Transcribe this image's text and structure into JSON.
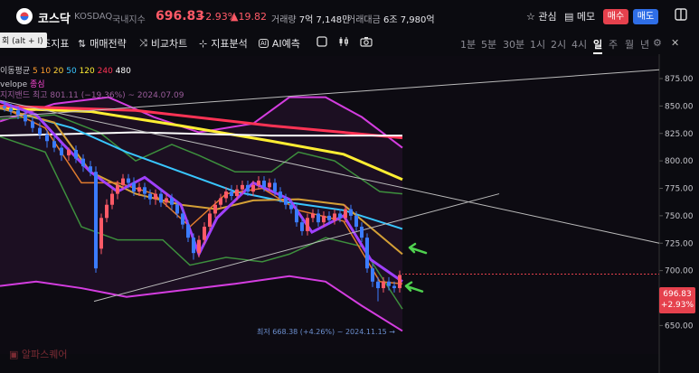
{
  "header": {
    "name": "코스닥",
    "code": "KOSDAQ",
    "market": "국내지수",
    "price": "696.83",
    "change_pct": "+2.93%",
    "change": "▲19.82",
    "volume_label": "거래량",
    "volume": "7억 7,148만",
    "amount_label": "거래대금",
    "amount": "6조 7,980억",
    "interest": "관심",
    "memo": "메모",
    "buy": "매수",
    "sell": "매도"
  },
  "toolbar": {
    "tooltip": "회 (alt + I)",
    "aux": "보조지표",
    "strategy": "매매전략",
    "compare": "비교차트",
    "analysis": "지표분석",
    "ai": "AI예측",
    "periods": [
      "1분",
      "5분",
      "30분",
      "1시",
      "2시",
      "4시",
      "일",
      "주",
      "월",
      "년"
    ],
    "active_period": "일"
  },
  "legend": {
    "ma_label": "이동평균",
    "ma_periods": [
      "5",
      "10",
      "20",
      "50",
      "120",
      "240",
      "480"
    ],
    "ma_colors": [
      "#ff9d2e",
      "#ff9d2e",
      "#ffd23a",
      "#39c6ff",
      "#ffee33",
      "#ff3355",
      "#ffffff"
    ],
    "envelope_label": "velope",
    "envelope_value": "종심",
    "high_label": "최고 801.11 (−19.36%) ~ 2024.07.09",
    "band_label": "지지밴드"
  },
  "chart": {
    "y_ticks": [
      "875.00",
      "850.00",
      "825.00",
      "800.00",
      "775.00",
      "750.00",
      "725.00",
      "700.00",
      "675.00",
      "650.00"
    ],
    "current_price": "696.83",
    "current_pct": "+2.93%",
    "low_note": "최저 668.38 (+4.26%) ~ 2024.11.15 →",
    "watermark": "알파스퀘어"
  },
  "colors": {
    "up": "#ff5a67",
    "down": "#3b7cff",
    "accent": "#e5414d",
    "buy": "#e5414d",
    "sell": "#2f6ee6"
  }
}
